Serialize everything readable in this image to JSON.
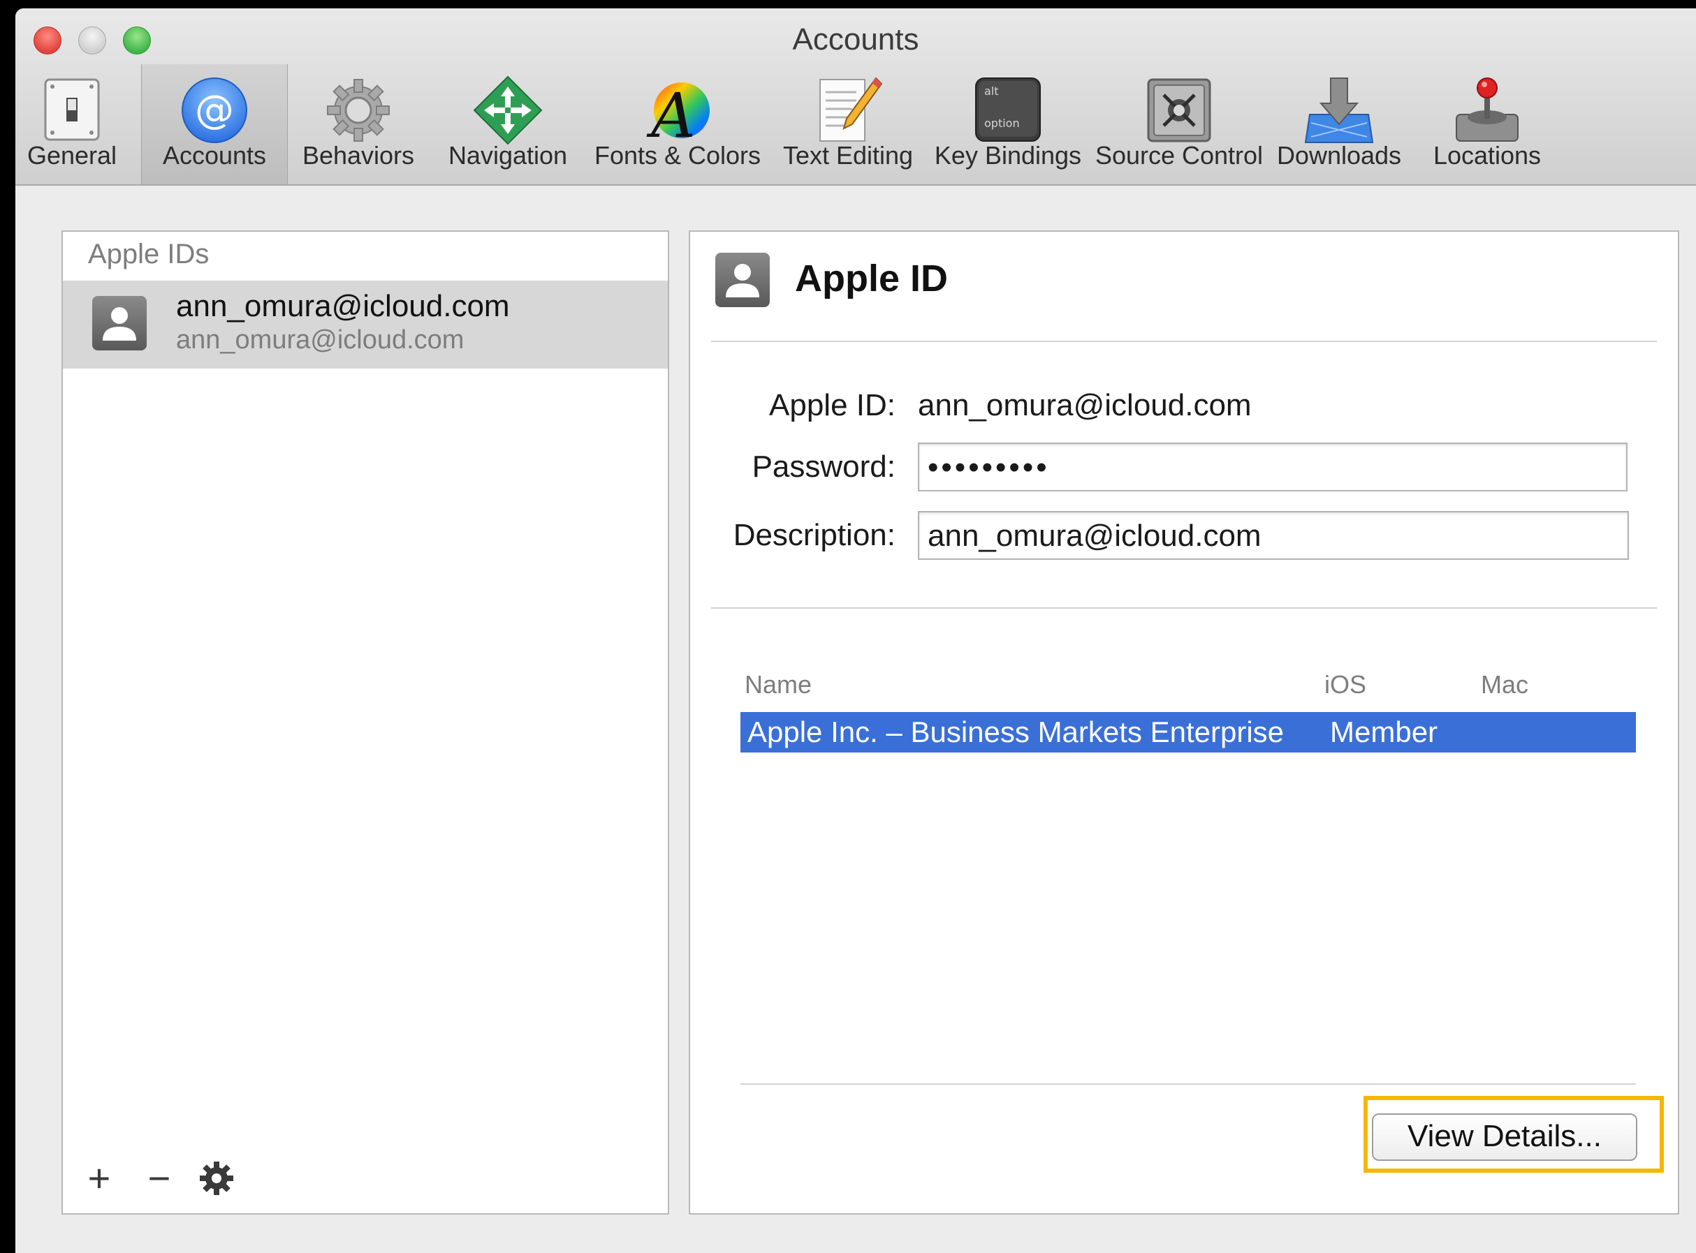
{
  "window": {
    "title": "Accounts"
  },
  "toolbar": {
    "items": [
      {
        "label": "General",
        "icon": "switch-icon"
      },
      {
        "label": "Accounts",
        "icon": "at-sign-icon",
        "active": true
      },
      {
        "label": "Behaviors",
        "icon": "gear-icon"
      },
      {
        "label": "Navigation",
        "icon": "navigation-arrows-icon"
      },
      {
        "label": "Fonts & Colors",
        "icon": "font-colors-icon"
      },
      {
        "label": "Text Editing",
        "icon": "pencil-document-icon"
      },
      {
        "label": "Key Bindings",
        "icon": "option-key-icon"
      },
      {
        "label": "Source Control",
        "icon": "vault-icon"
      },
      {
        "label": "Downloads",
        "icon": "download-tray-icon"
      },
      {
        "label": "Locations",
        "icon": "joystick-drive-icon"
      }
    ],
    "key_text_top": "alt",
    "key_text_bottom": "option"
  },
  "left_panel": {
    "header": "Apple IDs",
    "accounts": [
      {
        "name": "ann_omura@icloud.com",
        "subtitle": "ann_omura@icloud.com"
      }
    ],
    "tools": {
      "add": "+",
      "remove": "−"
    }
  },
  "detail": {
    "title": "Apple ID",
    "apple_id_label": "Apple ID:",
    "apple_id_value": "ann_omura@icloud.com",
    "password_label": "Password:",
    "password_value": "•••••••••",
    "description_label": "Description:",
    "description_value": "ann_omura@icloud.com",
    "table": {
      "columns": [
        "Name",
        "iOS",
        "Mac"
      ],
      "rows": [
        {
          "name": "Apple Inc. – Business Markets Enterprise",
          "ios": "Member",
          "mac": ""
        }
      ]
    },
    "view_details_label": "View Details..."
  },
  "colors": {
    "selection": "#3a6fd8",
    "highlight": "#f5b700"
  }
}
